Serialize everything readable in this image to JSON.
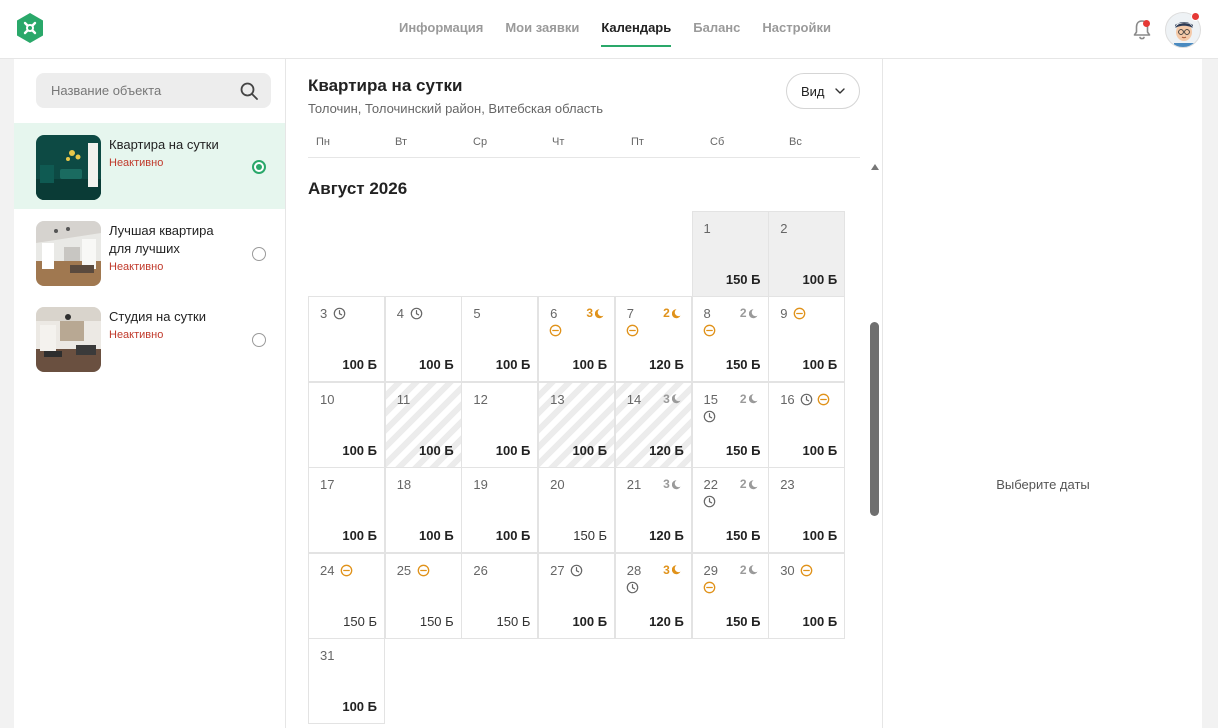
{
  "nav": {
    "items": [
      {
        "label": "Информация",
        "active": false
      },
      {
        "label": "Мои заявки",
        "active": false
      },
      {
        "label": "Календарь",
        "active": true
      },
      {
        "label": "Баланс",
        "active": false
      },
      {
        "label": "Настройки",
        "active": false
      }
    ]
  },
  "colors": {
    "accent": "#2aa86a",
    "inactive": "#c0392b",
    "orange": "#e0921a",
    "badge": "#e53935"
  },
  "sidebar": {
    "search_placeholder": "Название объекта",
    "properties": [
      {
        "title": "Квартира на сутки",
        "status": "Неактивно",
        "selected": true
      },
      {
        "title": "Лучшая квартира для лучших",
        "status": "Неактивно",
        "selected": false
      },
      {
        "title": "Студия на сутки",
        "status": "Неактивно",
        "selected": false
      }
    ]
  },
  "calendar": {
    "title": "Квартира на сутки",
    "address": "Толочин, Толочинский район, Витебская область",
    "view_label": "Вид",
    "weekdays": [
      "Пн",
      "Вт",
      "Ср",
      "Чт",
      "Пт",
      "Сб",
      "Вс"
    ],
    "month": "Август 2026",
    "days": [
      {
        "d": "1",
        "price": "150 Б",
        "bold": true,
        "style": "gray"
      },
      {
        "d": "2",
        "price": "100 Б",
        "bold": true,
        "style": "gray"
      },
      {
        "d": "3",
        "price": "100 Б",
        "bold": true,
        "icons": [
          "clock"
        ]
      },
      {
        "d": "4",
        "price": "100 Б",
        "bold": true,
        "icons": [
          "clock"
        ]
      },
      {
        "d": "5",
        "price": "100 Б",
        "bold": true
      },
      {
        "d": "6",
        "price": "100 Б",
        "bold": true,
        "nights": "3",
        "nights_color": "orange",
        "icons2": [
          "minus"
        ]
      },
      {
        "d": "7",
        "price": "120 Б",
        "bold": true,
        "nights": "2",
        "nights_color": "orange",
        "icons2": [
          "minus"
        ]
      },
      {
        "d": "8",
        "price": "150 Б",
        "bold": true,
        "nights": "2",
        "nights_color": "gray",
        "icons2": [
          "minus"
        ]
      },
      {
        "d": "9",
        "price": "100 Б",
        "bold": true,
        "icons": [
          "minus"
        ]
      },
      {
        "d": "10",
        "price": "100 Б",
        "bold": true
      },
      {
        "d": "11",
        "price": "100 Б",
        "bold": true,
        "style": "hatch"
      },
      {
        "d": "12",
        "price": "100 Б",
        "bold": true
      },
      {
        "d": "13",
        "price": "100 Б",
        "bold": true,
        "style": "hatch"
      },
      {
        "d": "14",
        "price": "120 Б",
        "bold": true,
        "style": "hatch",
        "nights": "3",
        "nights_color": "gray"
      },
      {
        "d": "15",
        "price": "150 Б",
        "bold": true,
        "nights": "2",
        "nights_color": "gray",
        "icons2": [
          "clock"
        ]
      },
      {
        "d": "16",
        "price": "100 Б",
        "bold": true,
        "icons": [
          "clock",
          "minus"
        ]
      },
      {
        "d": "17",
        "price": "100 Б",
        "bold": true
      },
      {
        "d": "18",
        "price": "100 Б",
        "bold": true
      },
      {
        "d": "19",
        "price": "100 Б",
        "bold": true
      },
      {
        "d": "20",
        "price": "150 Б",
        "bold": false
      },
      {
        "d": "21",
        "price": "120 Б",
        "bold": true,
        "nights": "3",
        "nights_color": "gray"
      },
      {
        "d": "22",
        "price": "150 Б",
        "bold": true,
        "nights": "2",
        "nights_color": "gray",
        "icons2": [
          "clock"
        ]
      },
      {
        "d": "23",
        "price": "100 Б",
        "bold": true
      },
      {
        "d": "24",
        "price": "150 Б",
        "bold": false,
        "icons": [
          "minus"
        ]
      },
      {
        "d": "25",
        "price": "150 Б",
        "bold": false,
        "icons": [
          "minus"
        ]
      },
      {
        "d": "26",
        "price": "150 Б",
        "bold": false
      },
      {
        "d": "27",
        "price": "100 Б",
        "bold": true,
        "icons": [
          "clock"
        ]
      },
      {
        "d": "28",
        "price": "120 Б",
        "bold": true,
        "nights": "3",
        "nights_color": "orange",
        "icons2": [
          "clock"
        ]
      },
      {
        "d": "29",
        "price": "150 Б",
        "bold": true,
        "nights": "2",
        "nights_color": "gray",
        "icons2": [
          "minus"
        ]
      },
      {
        "d": "30",
        "price": "100 Б",
        "bold": true,
        "icons": [
          "minus"
        ]
      },
      {
        "d": "31",
        "price": "100 Б",
        "bold": true
      }
    ],
    "first_weekday_index": 5
  },
  "details": {
    "placeholder": "Выберите даты"
  }
}
